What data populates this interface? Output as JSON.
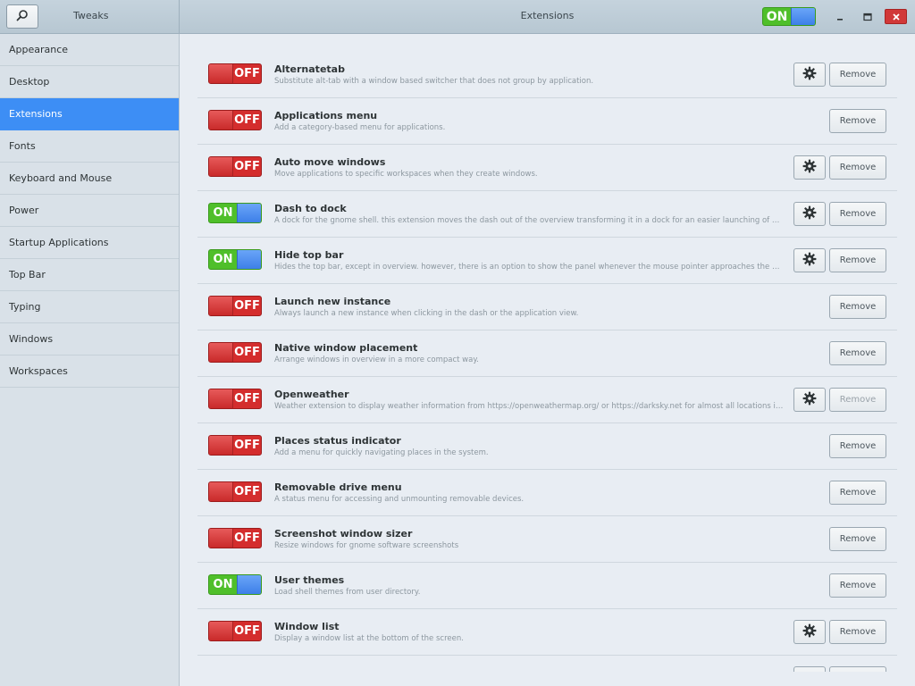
{
  "app_title": "Tweaks",
  "window_title": "Extensions",
  "master_toggle": {
    "state": "ON"
  },
  "window_controls": {
    "minimize_icon": "minimize-icon",
    "maximize_icon": "maximize-icon",
    "close_icon": "close-icon"
  },
  "sidebar": {
    "items": [
      {
        "label": "Appearance",
        "active": false
      },
      {
        "label": "Desktop",
        "active": false
      },
      {
        "label": "Extensions",
        "active": true
      },
      {
        "label": "Fonts",
        "active": false
      },
      {
        "label": "Keyboard and Mouse",
        "active": false
      },
      {
        "label": "Power",
        "active": false
      },
      {
        "label": "Startup Applications",
        "active": false
      },
      {
        "label": "Top Bar",
        "active": false
      },
      {
        "label": "Typing",
        "active": false
      },
      {
        "label": "Windows",
        "active": false
      },
      {
        "label": "Workspaces",
        "active": false
      }
    ]
  },
  "remove_label": "Remove",
  "extensions": [
    {
      "name": "Alternatetab",
      "description": "Substitute alt-tab with a window based switcher that does not group by application.",
      "state": "OFF",
      "has_settings": true,
      "remove_dim": false
    },
    {
      "name": "Applications menu",
      "description": "Add a category-based menu for applications.",
      "state": "OFF",
      "has_settings": false,
      "remove_dim": false
    },
    {
      "name": "Auto move windows",
      "description": "Move applications to specific workspaces when they create windows.",
      "state": "OFF",
      "has_settings": true,
      "remove_dim": false
    },
    {
      "name": "Dash to dock",
      "description": "A dock for the gnome shell. this extension moves the dash out of the overview transforming it in a dock for an easier launching of applications and a faster switching between windows and desktops.",
      "state": "ON",
      "has_settings": true,
      "remove_dim": false
    },
    {
      "name": "Hide top bar",
      "description": "Hides the top bar, except in overview. however, there is an option to show the panel whenever the mouse pointer approaches the edge of the screen.",
      "state": "ON",
      "has_settings": true,
      "remove_dim": false
    },
    {
      "name": "Launch new instance",
      "description": "Always launch a new instance when clicking in the dash or the application view.",
      "state": "OFF",
      "has_settings": false,
      "remove_dim": false
    },
    {
      "name": "Native window placement",
      "description": "Arrange windows in overview in a more compact way.",
      "state": "OFF",
      "has_settings": false,
      "remove_dim": false
    },
    {
      "name": "Openweather",
      "description": "Weather extension to display weather information from https://openweathermap.org/ or https://darksky.net for almost all locations in the world.",
      "state": "OFF",
      "has_settings": true,
      "remove_dim": true
    },
    {
      "name": "Places status indicator",
      "description": "Add a menu for quickly navigating places in the system.",
      "state": "OFF",
      "has_settings": false,
      "remove_dim": false
    },
    {
      "name": "Removable drive menu",
      "description": "A status menu for accessing and unmounting removable devices.",
      "state": "OFF",
      "has_settings": false,
      "remove_dim": false
    },
    {
      "name": "Screenshot window sizer",
      "description": "Resize windows for gnome software screenshots",
      "state": "OFF",
      "has_settings": false,
      "remove_dim": false
    },
    {
      "name": "User themes",
      "description": "Load shell themes from user directory.",
      "state": "ON",
      "has_settings": false,
      "remove_dim": false
    },
    {
      "name": "Window list",
      "description": "Display a window list at the bottom of the screen.",
      "state": "OFF",
      "has_settings": true,
      "remove_dim": false
    }
  ]
}
